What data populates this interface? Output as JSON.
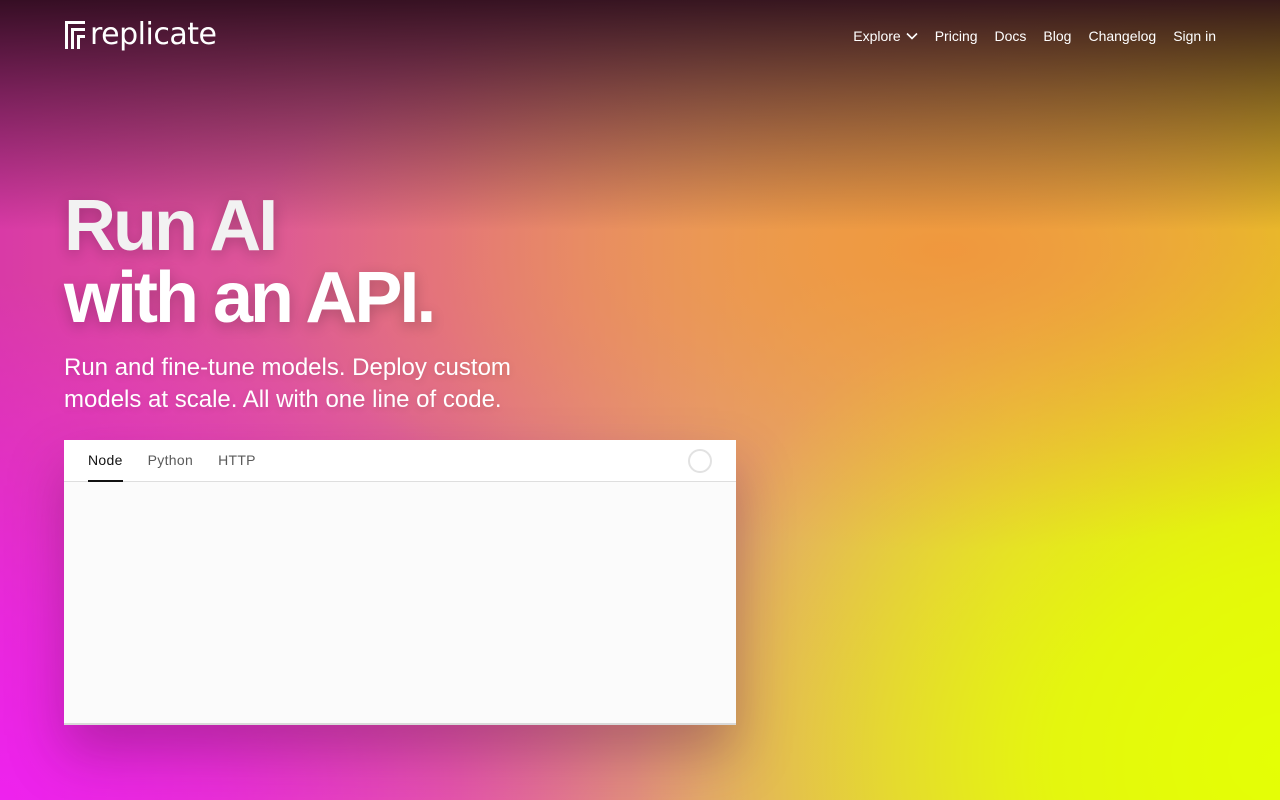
{
  "brand": {
    "name": "replicate",
    "logo_icon": "replicate-logo-icon"
  },
  "nav": {
    "items": [
      {
        "label": "Explore",
        "icon": "chevron-down-icon"
      },
      {
        "label": "Pricing"
      },
      {
        "label": "Docs"
      },
      {
        "label": "Blog"
      },
      {
        "label": "Changelog"
      },
      {
        "label": "Sign in"
      }
    ]
  },
  "hero": {
    "headline_line1": "Run AI",
    "headline_line2": "with an API.",
    "subhead": "Run and fine-tune models. Deploy custom models at scale. All with one line of code."
  },
  "code_panel": {
    "tabs": [
      {
        "label": "Node",
        "active": true
      },
      {
        "label": "Python",
        "active": false
      },
      {
        "label": "HTTP",
        "active": false
      }
    ],
    "loading_icon": "loading-spinner-icon"
  },
  "colors": {
    "header_dark": "#280a19",
    "magenta": "#ee22ee",
    "orange": "#f0963c",
    "lime": "#e4ff05",
    "card_bg": "#fbfbfb",
    "active_tab": "#111111"
  }
}
